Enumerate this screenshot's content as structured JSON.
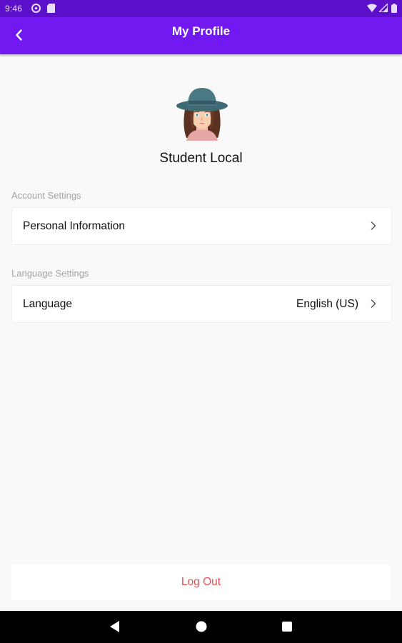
{
  "status_bar": {
    "time": "9:46",
    "icons": [
      "settings-gear-icon",
      "sd-card-icon",
      "wifi-icon",
      "signal-icon",
      "battery-icon"
    ]
  },
  "app_bar": {
    "title": "My Profile",
    "back_icon": "chevron-left-icon",
    "color": "#7218f0"
  },
  "profile": {
    "name": "Student Local",
    "avatar_icon": "woman-avatar-icon"
  },
  "account_settings": {
    "label": "Account Settings",
    "items": [
      {
        "label": "Personal Information",
        "icon": "chevron-right-icon"
      }
    ]
  },
  "language_settings": {
    "label": "Language Settings",
    "items": [
      {
        "label": "Language",
        "value": "English (US)",
        "icon": "chevron-right-icon"
      }
    ]
  },
  "logout": {
    "label": "Log Out",
    "color": "#e05252"
  },
  "nav_bar": {
    "buttons": [
      "back-triangle-icon",
      "home-circle-icon",
      "recents-square-icon"
    ]
  }
}
